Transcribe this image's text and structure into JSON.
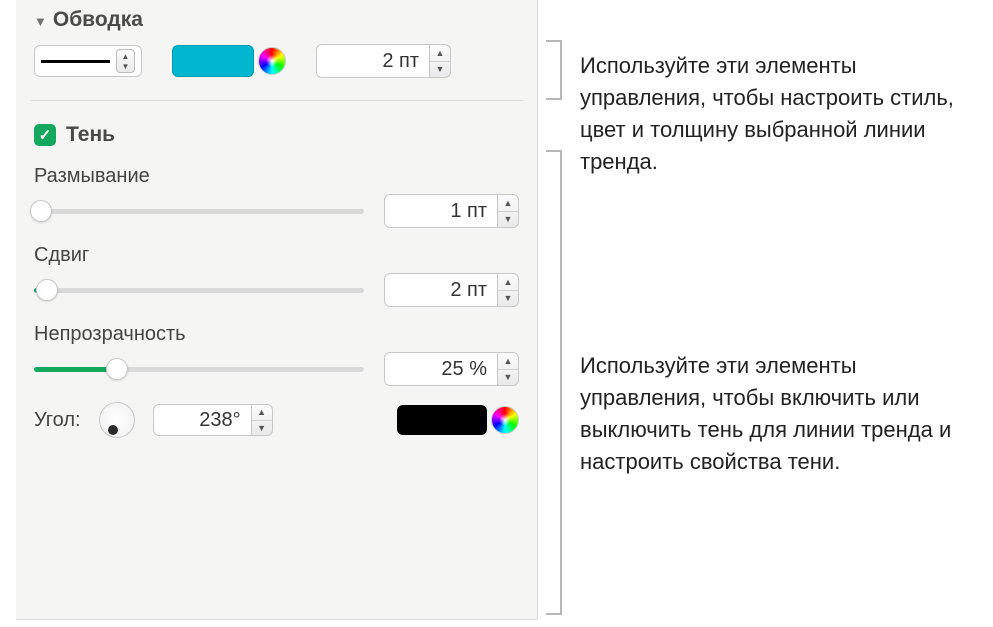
{
  "stroke": {
    "title": "Обводка",
    "thickness_value": "2 пт",
    "color": "#00b7cf"
  },
  "shadow": {
    "title": "Тень",
    "checked": true,
    "blur": {
      "label": "Размывание",
      "value": "1 пт",
      "slider_percent": 2
    },
    "offset": {
      "label": "Сдвиг",
      "value": "2 пт",
      "slider_percent": 4
    },
    "opacity": {
      "label": "Непрозрачность",
      "value": "25 %",
      "slider_percent": 25
    },
    "angle": {
      "label": "Угол:",
      "value": "238°",
      "degrees": 238
    },
    "color": "#000000"
  },
  "callouts": {
    "stroke": "Используйте эти элементы управления, чтобы настроить стиль, цвет и толщину выбранной линии тренда.",
    "shadow": "Используйте эти элементы управления, чтобы включить или выключить тень для линии тренда и настроить свойства тени."
  }
}
